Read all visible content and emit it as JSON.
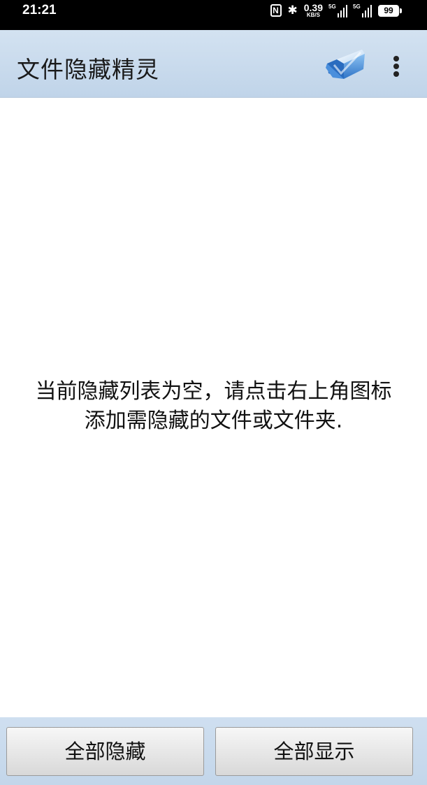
{
  "status_bar": {
    "time": "21:21",
    "nfc": "N",
    "bluetooth": "✱",
    "net_speed_value": "0.39",
    "net_speed_unit": "KB/S",
    "signal1_tag": "5G",
    "signal2_tag": "5G",
    "battery_level": "99"
  },
  "app_bar": {
    "title": "文件隐藏精灵",
    "add_icon": "folder-check-icon",
    "menu_icon": "more-vert-icon"
  },
  "empty_state": {
    "line1": "当前隐藏列表为空，请点击右上角图标",
    "line2": "添加需隐藏的文件或文件夹."
  },
  "bottom_bar": {
    "hide_all_label": "全部隐藏",
    "show_all_label": "全部显示"
  },
  "colors": {
    "app_bar_bg": "#c8daee",
    "status_bar_bg": "#000000",
    "folder_blue": "#3e86d6"
  }
}
